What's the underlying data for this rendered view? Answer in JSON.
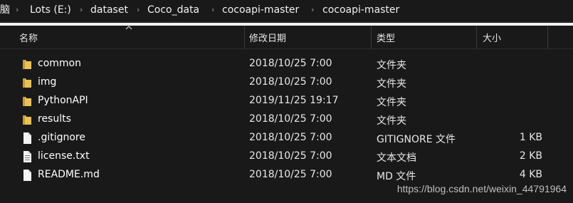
{
  "breadcrumb": {
    "items": [
      "脑",
      "Lots (E:)",
      "dataset",
      "Coco_data",
      "cocoapi-master",
      "cocoapi-master"
    ]
  },
  "columns": {
    "name": "名称",
    "date": "修改日期",
    "type": "类型",
    "size": "大小"
  },
  "files": [
    {
      "name": "common",
      "date": "2018/10/25 7:00",
      "type": "文件夹",
      "size": "",
      "icon": "folder-icon"
    },
    {
      "name": "img",
      "date": "2018/10/25 7:00",
      "type": "文件夹",
      "size": "",
      "icon": "folder-icon"
    },
    {
      "name": "PythonAPI",
      "date": "2019/11/25 19:17",
      "type": "文件夹",
      "size": "",
      "icon": "folder-icon"
    },
    {
      "name": "results",
      "date": "2018/10/25 7:00",
      "type": "文件夹",
      "size": "",
      "icon": "folder-icon"
    },
    {
      "name": ".gitignore",
      "date": "2018/10/25 7:00",
      "type": "GITIGNORE 文件",
      "size": "1 KB",
      "icon": "file-icon"
    },
    {
      "name": "license.txt",
      "date": "2018/10/25 7:00",
      "type": "文本文档",
      "size": "2 KB",
      "icon": "text-file-icon"
    },
    {
      "name": "README.md",
      "date": "2018/10/25 7:00",
      "type": "MD 文件",
      "size": "4 KB",
      "icon": "file-icon"
    }
  ],
  "watermark": "https://blog.csdn.net/weixin_44791964",
  "colors": {
    "background": "#191919",
    "folder": "#e8c15a",
    "text": "#ffffff"
  }
}
